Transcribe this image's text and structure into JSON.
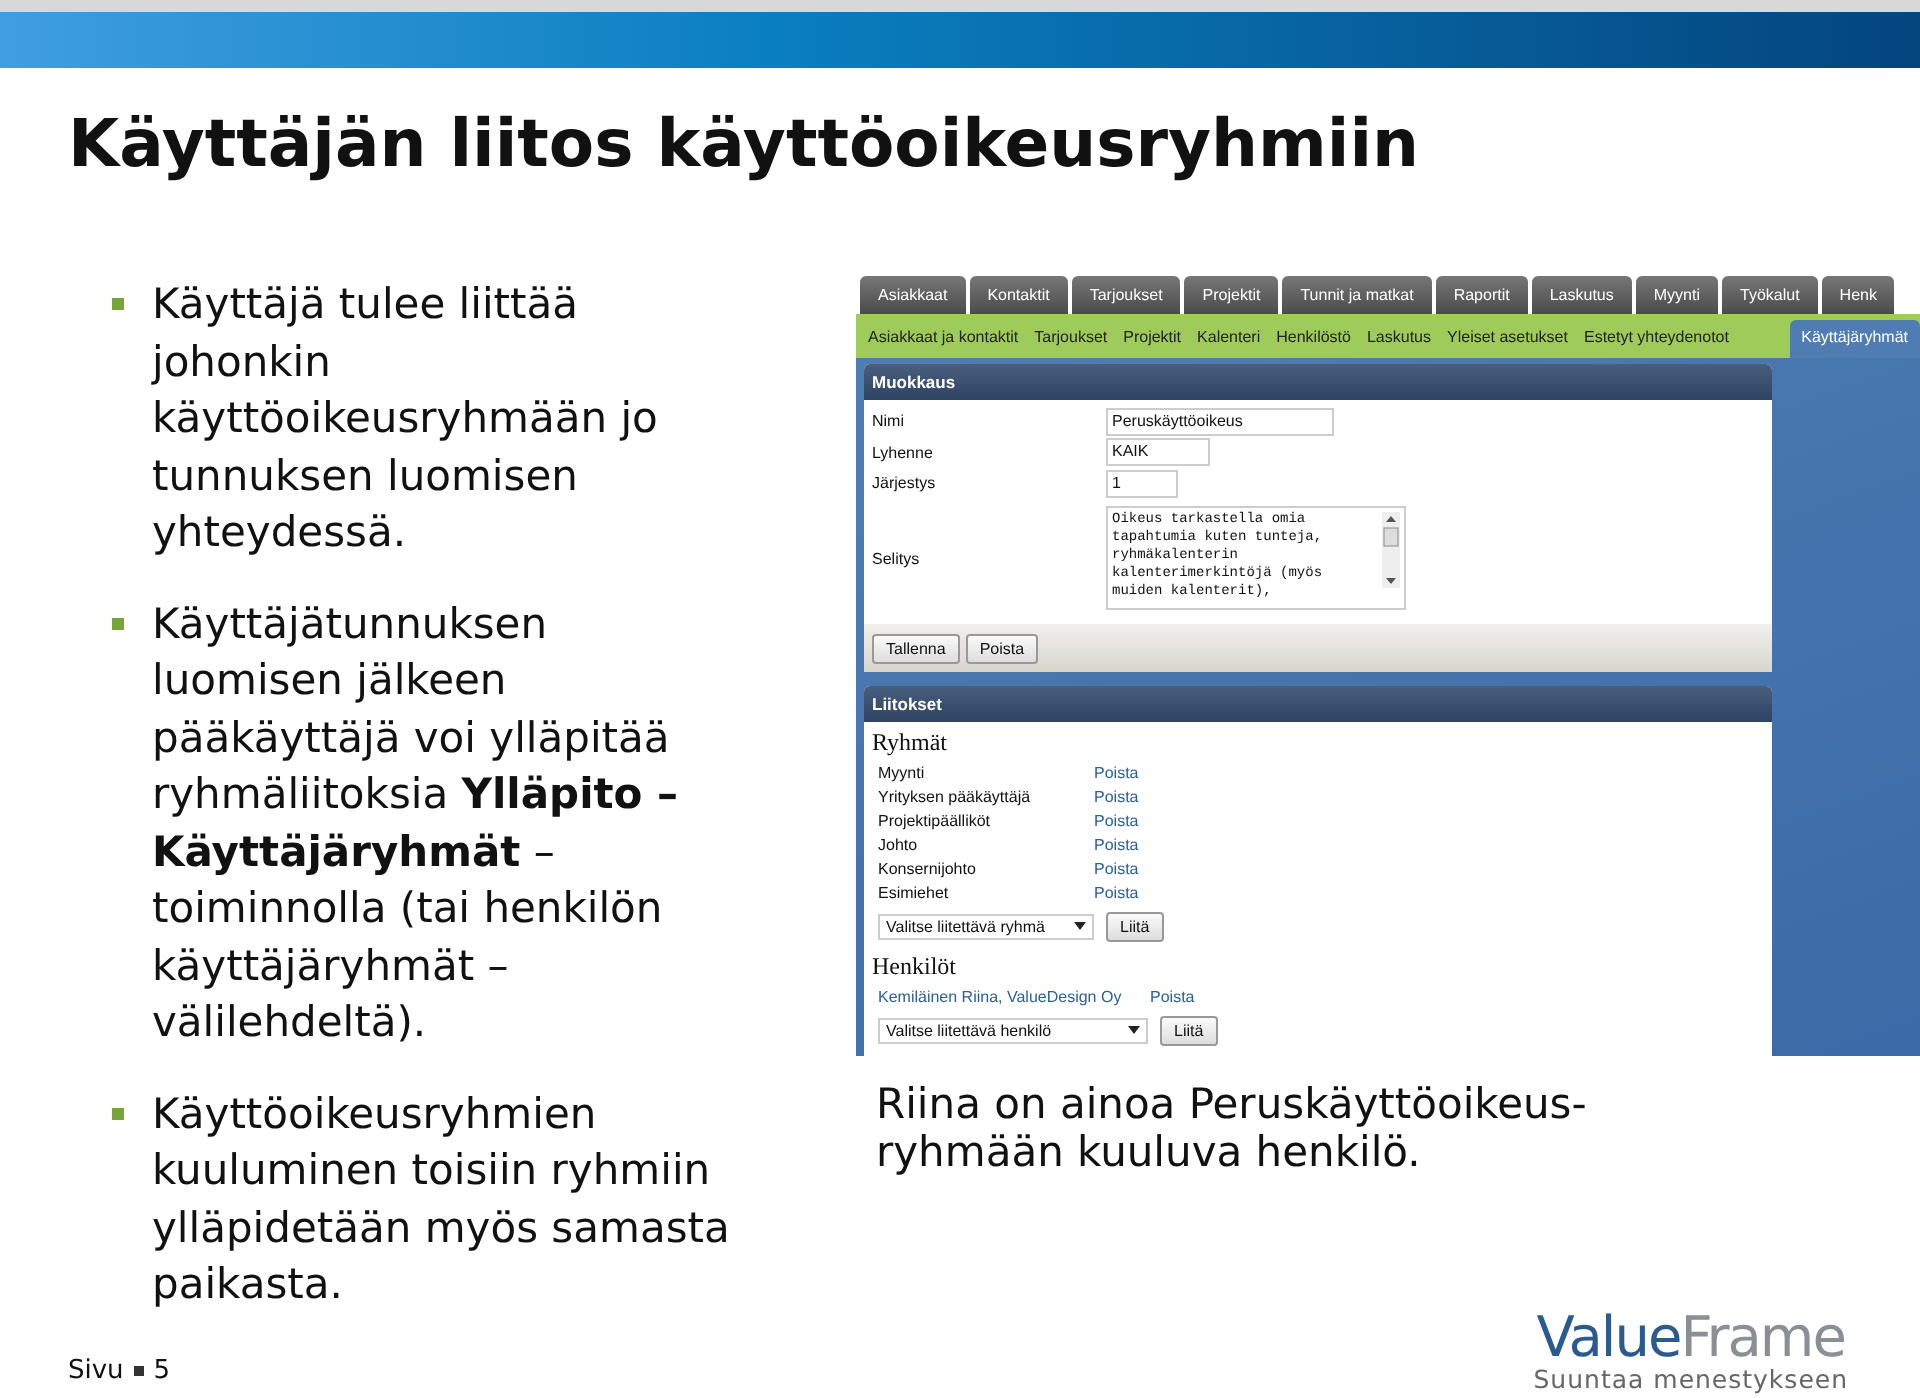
{
  "title": "Käyttäjän liitos käyttöoikeusryhmiin",
  "bullets": [
    {
      "text": "Käyttäjä tulee liittää johonkin käyttöoikeusryhmään jo tunnuksen luomisen yhteydessä."
    },
    {
      "text": "Käyttäjätunnuksen luomisen jälkeen pääkäyttäjä voi ylläpitää ryhmäliitoksia **Ylläpito – Käyttäjäryhmät** – toiminnolla (tai henkilön käyttäjäryhmät – välilehdeltä)."
    },
    {
      "text": "Käyttöoikeusryhmien kuuluminen toisiin ryhmiin ylläpidetään myös samasta paikasta."
    }
  ],
  "screenshot": {
    "top_tabs": [
      "Asiakkaat",
      "Kontaktit",
      "Tarjoukset",
      "Projektit",
      "Tunnit ja matkat",
      "Raportit",
      "Laskutus",
      "Myynti",
      "Työkalut",
      "Henk"
    ],
    "sub_tabs": [
      {
        "label": "Asiakkaat ja kontaktit",
        "selected": false
      },
      {
        "label": "Tarjoukset",
        "selected": false
      },
      {
        "label": "Projektit",
        "selected": false
      },
      {
        "label": "Kalenteri",
        "selected": false
      },
      {
        "label": "Henkilöstö",
        "selected": false
      },
      {
        "label": "Laskutus",
        "selected": false
      },
      {
        "label": "Yleiset asetukset",
        "selected": false
      },
      {
        "label": "Estetyt yhteydenotot",
        "selected": false
      },
      {
        "label": "Käyttäjäryhmät",
        "selected": true
      }
    ],
    "edit_panel": {
      "title": "Muokkaus",
      "fields": [
        {
          "kind": "text",
          "label": "Nimi",
          "value": "Peruskäyttöoikeus"
        },
        {
          "kind": "text",
          "label": "Lyhenne",
          "value": "KAIK"
        },
        {
          "kind": "text",
          "label": "Järjestys",
          "value": "1"
        },
        {
          "kind": "textarea",
          "label": "Selitys",
          "value": "Oikeus tarkastella omia tapahtumia kuten tunteja, ryhmäkalenterin kalenterimerkintöjä (myös muiden kalenterit),"
        }
      ],
      "buttons": [
        "Tallenna",
        "Poista"
      ]
    },
    "links_panel": {
      "title": "Liitokset",
      "groups_heading": "Ryhmät",
      "groups": [
        {
          "name": "Myynti",
          "action": "Poista"
        },
        {
          "name": "Yrityksen pääkäyttäjä",
          "action": "Poista"
        },
        {
          "name": "Projektipäälliköt",
          "action": "Poista"
        },
        {
          "name": "Johto",
          "action": "Poista"
        },
        {
          "name": "Konsernijohto",
          "action": "Poista"
        },
        {
          "name": "Esimiehet",
          "action": "Poista"
        }
      ],
      "group_select": "Valitse liitettävä ryhmä",
      "group_button": "Liitä",
      "persons_heading": "Henkilöt",
      "persons": [
        {
          "name": "Kemiläinen Riina, ValueDesign Oy",
          "action": "Poista"
        }
      ],
      "person_select": "Valitse liitettävä henkilö",
      "person_button": "Liitä"
    }
  },
  "caption": "Riina on ainoa Peruskäyttöoikeus-ryhmään kuuluva henkilö.",
  "footer": {
    "page_label": "Sivu",
    "page_number": "5"
  },
  "logo": {
    "first": "Value",
    "second": "Frame",
    "tagline": "Suuntaa menestykseen"
  }
}
